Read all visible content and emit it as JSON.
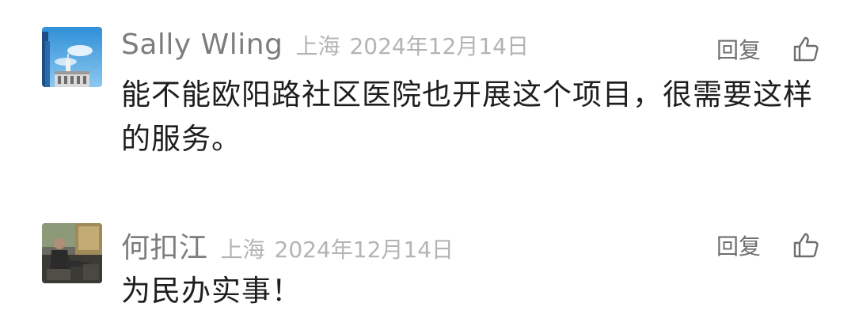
{
  "comments": [
    {
      "nickname": "Sally   Wling",
      "location": "上海",
      "date": "2024年12月14日",
      "reply_label": "回复",
      "text": "能不能欧阳路社区医院也开展这个项目，很需要这样的服务。",
      "like_icon": "thumbs-up-icon"
    },
    {
      "nickname": "何扣江",
      "location": "上海",
      "date": "2024年12月14日",
      "reply_label": "回复",
      "text": "为民办实事！",
      "like_icon": "thumbs-up-icon"
    }
  ],
  "colors": {
    "nickname": "#7d7d7d",
    "meta": "#b4b4b4",
    "body": "#1e1e1e",
    "action": "#6e6e6e"
  }
}
